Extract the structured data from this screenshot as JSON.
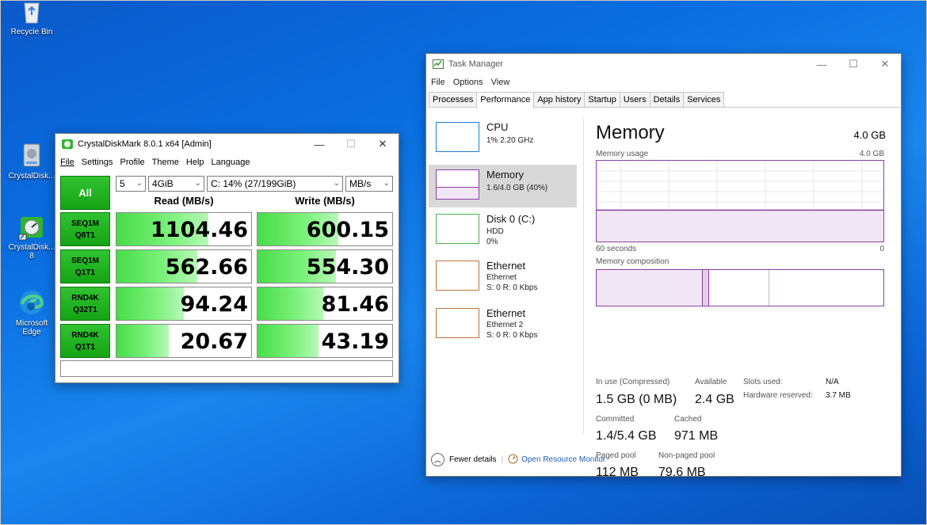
{
  "desktop": {
    "icons": [
      {
        "label": "Recycle Bin"
      },
      {
        "label": "CrystalDisk..."
      },
      {
        "label": "CrystalDisk...",
        "label2": "8"
      },
      {
        "label": "Microsoft",
        "label2": "Edge"
      }
    ]
  },
  "cdm": {
    "title": "CrystalDiskMark 8.0.1 x64 [Admin]",
    "menu": [
      "File",
      "Settings",
      "Profile",
      "Theme",
      "Help",
      "Language"
    ],
    "all_label": "All",
    "count": "5",
    "size": "4GiB",
    "drive": "C: 14% (27/199GiB)",
    "unit": "MB/s",
    "read_header": "Read (MB/s)",
    "write_header": "Write (MB/s)",
    "tests": [
      {
        "line1": "SEQ1M",
        "line2": "Q8T1",
        "read": "1104.46",
        "write": "600.15",
        "read_fill": 0.68,
        "write_fill": 0.6
      },
      {
        "line1": "SEQ1M",
        "line2": "Q1T1",
        "read": "562.66",
        "write": "554.30",
        "read_fill": 0.6,
        "write_fill": 0.58
      },
      {
        "line1": "RND4K",
        "line2": "Q32T1",
        "read": "94.24",
        "write": "81.46",
        "read_fill": 0.5,
        "write_fill": 0.49
      },
      {
        "line1": "RND4K",
        "line2": "Q1T1",
        "read": "20.67",
        "write": "43.19",
        "read_fill": 0.39,
        "write_fill": 0.45
      }
    ],
    "comment": ""
  },
  "tm": {
    "title": "Task Manager",
    "menu": [
      "File",
      "Options",
      "View"
    ],
    "tabs": [
      "Processes",
      "Performance",
      "App history",
      "Startup",
      "Users",
      "Details",
      "Services"
    ],
    "active_tab": "Performance",
    "items": [
      {
        "name": "CPU",
        "sub1": "1% 2.20 GHz",
        "sub2": "",
        "color": "#1c7fd1"
      },
      {
        "name": "Memory",
        "sub1": "1.6/4.0 GB (40%)",
        "sub2": "",
        "color": "#8b3fa6"
      },
      {
        "name": "Disk 0 (C:)",
        "sub1": "HDD",
        "sub2": "0%",
        "color": "#4caf50"
      },
      {
        "name": "Ethernet",
        "sub1": "Ethernet",
        "sub2": "S: 0 R: 0 Kbps",
        "color": "#b8743a"
      },
      {
        "name": "Ethernet",
        "sub1": "Ethernet 2",
        "sub2": "S: 0 R: 0 Kbps",
        "color": "#b8743a"
      }
    ],
    "memory": {
      "title": "Memory",
      "total": "4.0 GB",
      "usage_label": "Memory usage",
      "usage_max": "4.0 GB",
      "axis_left": "60 seconds",
      "axis_right": "0",
      "composition_label": "Memory composition",
      "usage_fraction": 0.4,
      "stats": {
        "in_use_label": "In use (Compressed)",
        "in_use": "1.5 GB (0 MB)",
        "available_label": "Available",
        "available": "2.4 GB",
        "committed_label": "Committed",
        "committed": "1.4/5.4 GB",
        "cached_label": "Cached",
        "cached": "971 MB",
        "paged_label": "Paged pool",
        "paged": "112 MB",
        "nonpaged_label": "Non-paged pool",
        "nonpaged": "79.6 MB",
        "slots_label": "Slots used:",
        "slots": "N/A",
        "hw_label": "Hardware reserved:",
        "hw": "3.7 MB"
      }
    },
    "footer": {
      "fewer": "Fewer details",
      "resmon": "Open Resource Monitor"
    }
  },
  "colors": {
    "accent_green": "#14a314",
    "memory_purple": "#8b3fa6",
    "link_blue": "#1a5fb4"
  }
}
